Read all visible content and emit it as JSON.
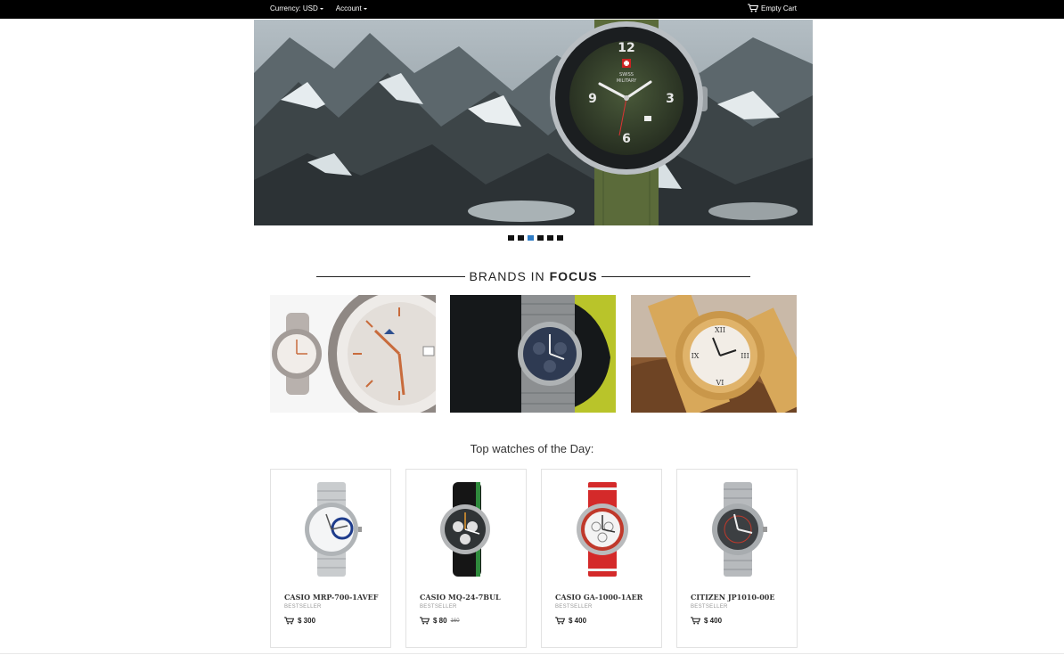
{
  "topbar": {
    "currency_label": "Currency: USD",
    "account_label": "Account",
    "cart_label": "Empty Cart"
  },
  "hero": {
    "slide_count": 6,
    "active_slide": 3,
    "watch_brand": [
      "SWISS",
      "MILITARY"
    ]
  },
  "brands": {
    "heading_light": "BRANDS IN",
    "heading_bold": "FOCUS"
  },
  "top_watches": {
    "title": "Top watches of the Day:",
    "products": [
      {
        "name": "CASIO MRP-700-1AVEF",
        "badge": "BESTSELLER",
        "price": "$ 300",
        "old_price": ""
      },
      {
        "name": "CASIO MQ-24-7BUL",
        "badge": "BESTSELLER",
        "price": "$ 80",
        "old_price": "160"
      },
      {
        "name": "CASIO GA-1000-1AER",
        "badge": "BESTSELLER",
        "price": "$ 400",
        "old_price": ""
      },
      {
        "name": "CITIZEN JP1010-00E",
        "badge": "BESTSELLER",
        "price": "$ 400",
        "old_price": ""
      }
    ]
  },
  "icons": {
    "cart": "cart-icon",
    "caret": "caret-down-icon"
  },
  "colors": {
    "topbar_bg": "#000000",
    "active_dot": "#2e7bc4",
    "card_border": "#e2e2e2"
  }
}
